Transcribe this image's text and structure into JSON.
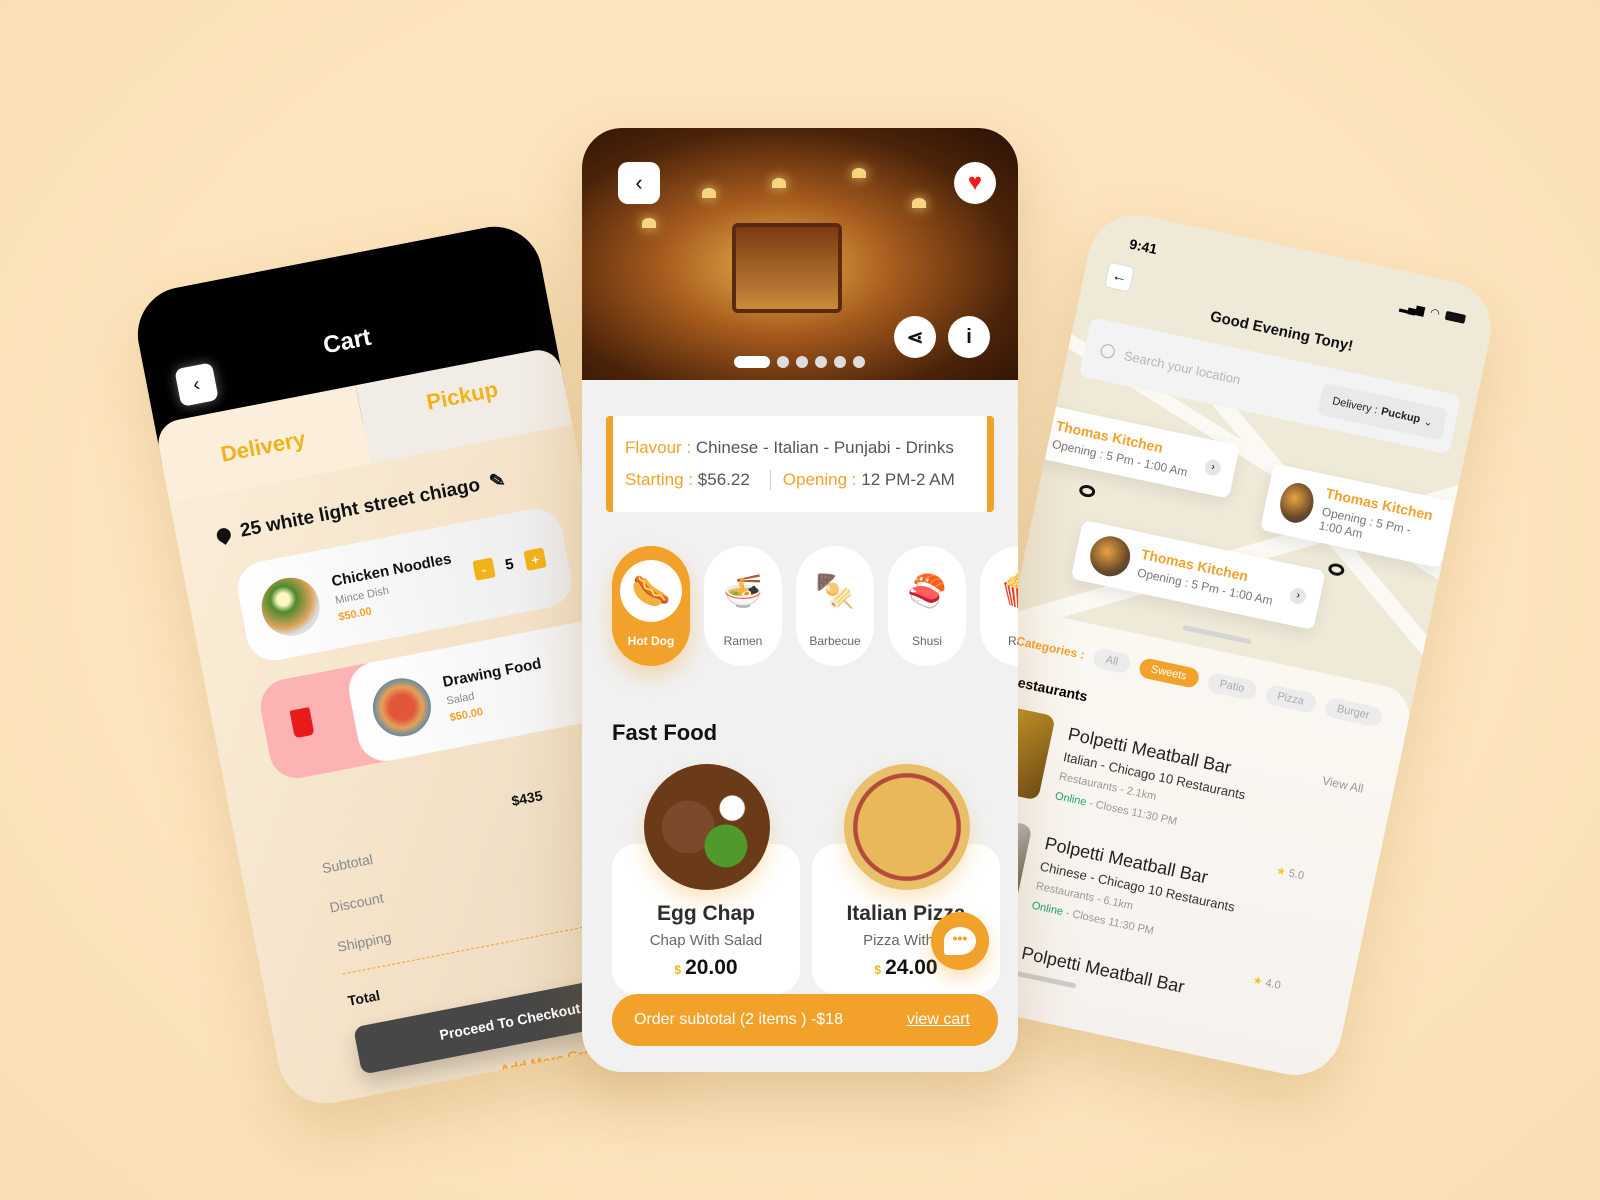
{
  "colors": {
    "accent": "#f2a22a",
    "background": "#fce4bd",
    "dark": "#000000",
    "delete": "#fdb3b3"
  },
  "cart": {
    "title": "Cart",
    "tabs": [
      "Delivery",
      "Pickup"
    ],
    "address": "25 white light street chiago",
    "items": [
      {
        "name": "Chicken Noodles",
        "sub": "Mince Dish",
        "price": "$50.00",
        "qty": "5"
      },
      {
        "name": "Drawing Food",
        "sub": "Salad",
        "price": "$50.00"
      }
    ],
    "summary": {
      "subtotal_label": "Subtotal",
      "subtotal_value": "$435",
      "discount_label": "Discount",
      "discount_value": "-$",
      "shipping_label": "Shipping",
      "total_label": "Total",
      "total_value": "$"
    },
    "checkout_label": "Proceed To Checkout",
    "add_more_label": "Add More Great Food Items"
  },
  "restaurant": {
    "info": {
      "flavour_label": "Flavour :",
      "flavour_value": "Chinese - Italian - Punjabi - Drinks",
      "starting_label": "Starting :",
      "starting_value": "$56.22",
      "opening_label": "Opening :",
      "opening_value": "12 PM-2 AM"
    },
    "gallery_page": 1,
    "gallery_pages": 6,
    "categories": [
      {
        "label": "Hot Dog",
        "icon": "🌭",
        "active": true
      },
      {
        "label": "Ramen",
        "icon": "🍜"
      },
      {
        "label": "Barbecue",
        "icon": "🍢"
      },
      {
        "label": "Shusi",
        "icon": "🍣"
      },
      {
        "label": "Ran",
        "icon": "🍿"
      }
    ],
    "section_title": "Fast Food",
    "foods": [
      {
        "name": "Egg Chap",
        "desc": "Chap With Salad",
        "currency": "$",
        "price": "20.00"
      },
      {
        "name": "Italian Pizza",
        "desc": "Pizza With C",
        "currency": "$",
        "price": "24.00"
      }
    ],
    "order_bar": {
      "text": "Order subtotal (2 items ) -$18",
      "link": "view cart"
    }
  },
  "map": {
    "time": "9:41",
    "greeting": "Good Evening Tony!",
    "search_placeholder": "Search your location",
    "delivery_label": "Delivery :",
    "delivery_value": "Puckup",
    "pins": [
      {
        "title": "Thomas Kitchen",
        "hours": "Opening : 5 Pm - 1:00 Am"
      },
      {
        "title": "Thomas Kitchen",
        "hours": "Opening : 5 Pm - 1:00 Am"
      },
      {
        "title": "Thomas Kitchen",
        "hours": "Opening : 5 Pm - 1:00 Am"
      }
    ],
    "categories_label": "Categories :",
    "chips": [
      "All",
      "Sweets",
      "Patio",
      "Pizza",
      "Burger"
    ],
    "restaurants_label": "Restaurants",
    "view_all": "View All",
    "restaurants": [
      {
        "name": "Polpetti Meatball Bar",
        "cuisine": "Italian - Chicago 10 Restaurants",
        "distance": "Restaurants - 2.1km",
        "status": "Online",
        "closes": " - Closes 11:30 PM",
        "rating": "5.0"
      },
      {
        "name": "Polpetti Meatball Bar",
        "cuisine": "Chinese - Chicago 10 Restaurants",
        "distance": "Restaurants - 6.1km",
        "status": "Online",
        "closes": " - Closes 11:30 PM",
        "rating": "4.0"
      },
      {
        "name": "Polpetti Meatball Bar"
      }
    ]
  }
}
